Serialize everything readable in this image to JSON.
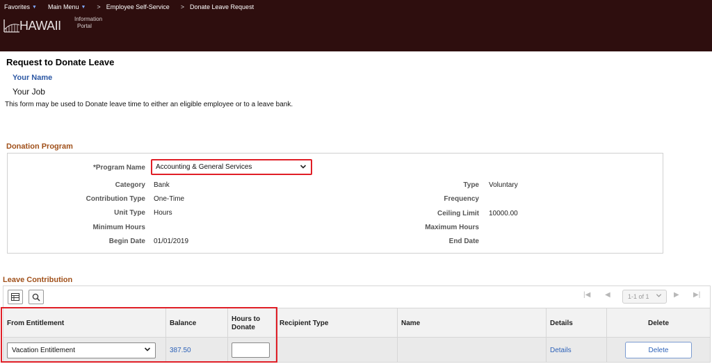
{
  "nav": {
    "favorites": "Favorites",
    "main_menu": "Main Menu",
    "breadcrumbs": [
      "Employee Self-Service",
      "Donate Leave Request"
    ],
    "caret_icon": "caret-down-icon",
    "separator": ">"
  },
  "logo": {
    "main": "HAWAII",
    "sub1": "Information",
    "sub2": "Portal"
  },
  "page": {
    "title": "Request to Donate Leave",
    "your_name": "Your Name",
    "your_job": "Your Job",
    "instructions": "This form may be used to Donate leave time to either an eligible employee or to a leave bank."
  },
  "donation_program": {
    "section_title": "Donation Program",
    "program_name_label": "*Program Name",
    "program_name_value": "Accounting & General Services",
    "left_fields": [
      {
        "label": "Category",
        "value": "Bank"
      },
      {
        "label": "Contribution Type",
        "value": "One-Time"
      },
      {
        "label": "Unit Type",
        "value": "Hours"
      },
      {
        "label": "Minimum Hours",
        "value": ""
      },
      {
        "label": "Begin Date",
        "value": "01/01/2019"
      }
    ],
    "right_fields": [
      {
        "label": "Type",
        "value": "Voluntary"
      },
      {
        "label": "Frequency",
        "value": ""
      },
      {
        "label": "Ceiling Limit",
        "value": "10000.00"
      },
      {
        "label": "Maximum Hours",
        "value": ""
      },
      {
        "label": "End Date",
        "value": ""
      }
    ]
  },
  "leave_contribution": {
    "section_title": "Leave Contribution",
    "pager_text": "1-1 of 1",
    "columns": [
      "From Entitlement",
      "Balance",
      "Hours to Donate",
      "Recipient Type",
      "Name",
      "Details",
      "Delete"
    ],
    "rows": [
      {
        "from_entitlement": "Vacation Entitlement",
        "balance": "387.50",
        "hours_to_donate": "",
        "recipient_type": "",
        "name": "",
        "details": "Details",
        "delete": "Delete"
      }
    ]
  },
  "colors": {
    "header_bg": "#2e0e0e",
    "section_title": "#a0501a",
    "link": "#2d62b8",
    "highlight": "#e01e26"
  }
}
